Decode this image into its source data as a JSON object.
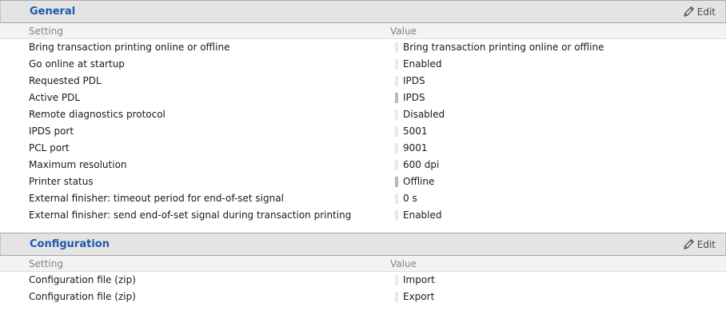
{
  "general": {
    "title": "General",
    "edit_label": "Edit",
    "columns": {
      "setting": "Setting",
      "value": "Value"
    },
    "rows": [
      {
        "label": "Bring transaction printing online or offline",
        "value": "Bring transaction printing online or offline",
        "marker": "light"
      },
      {
        "label": "Go online at startup",
        "value": "Enabled",
        "marker": "light"
      },
      {
        "label": "Requested PDL",
        "value": "IPDS",
        "marker": "light"
      },
      {
        "label": "Active PDL",
        "value": "IPDS",
        "marker": "strong"
      },
      {
        "label": "Remote diagnostics protocol",
        "value": "Disabled",
        "marker": "light"
      },
      {
        "label": "IPDS port",
        "value": "5001",
        "marker": "light"
      },
      {
        "label": "PCL port",
        "value": "9001",
        "marker": "light"
      },
      {
        "label": "Maximum resolution",
        "value": "600 dpi",
        "marker": "light"
      },
      {
        "label": "Printer status",
        "value": "Offline",
        "marker": "strong"
      },
      {
        "label": "External finisher: timeout period for end-of-set signal",
        "value": "0 s",
        "marker": "light"
      },
      {
        "label": "External finisher: send end-of-set signal during transaction printing",
        "value": "Enabled",
        "marker": "light"
      }
    ]
  },
  "configuration": {
    "title": "Configuration",
    "edit_label": "Edit",
    "columns": {
      "setting": "Setting",
      "value": "Value"
    },
    "rows": [
      {
        "label": "Configuration file (zip)",
        "value": "Import",
        "marker": "light"
      },
      {
        "label": "Configuration file (zip)",
        "value": "Export",
        "marker": "light"
      }
    ]
  },
  "icons": {
    "edit": "pencil-icon"
  },
  "colors": {
    "title": "#1d5aa8",
    "header_bg": "#e4e4e4",
    "column_header_text": "#7a8590"
  }
}
